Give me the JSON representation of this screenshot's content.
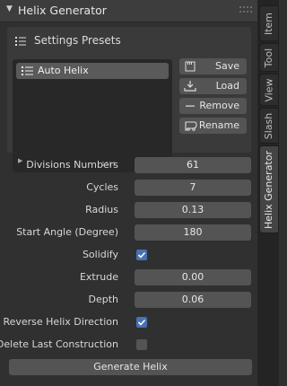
{
  "panel": {
    "title": "Helix Generator",
    "presets": {
      "title": "Settings Presets",
      "items": [
        "Auto Helix"
      ],
      "buttons": {
        "save": "Save",
        "load": "Load",
        "remove": "Remove",
        "rename": "Rename"
      }
    },
    "fields": {
      "divisions": {
        "label": "Divisions Numbers",
        "value": "61"
      },
      "cycles": {
        "label": "Cycles",
        "value": "7"
      },
      "radius": {
        "label": "Radius",
        "value": "0.13"
      },
      "start_angle": {
        "label": "Start Angle (Degree)",
        "value": "180"
      },
      "solidify": {
        "label": "Solidify",
        "checked": true
      },
      "extrude": {
        "label": "Extrude",
        "value": "0.00"
      },
      "depth": {
        "label": "Depth",
        "value": "0.06"
      },
      "reverse": {
        "label": "Reverse Helix Direction",
        "checked": true
      },
      "delete_last": {
        "label": "Delete Last Construction",
        "checked": false
      }
    },
    "generate_button": "Generate Helix"
  },
  "tabs": [
    "Item",
    "Tool",
    "View",
    "Slash",
    "Helix Generator"
  ],
  "active_tab": "Helix Generator",
  "colors": {
    "accent": "#4772b3",
    "panel": "#303030",
    "field": "#545454"
  }
}
